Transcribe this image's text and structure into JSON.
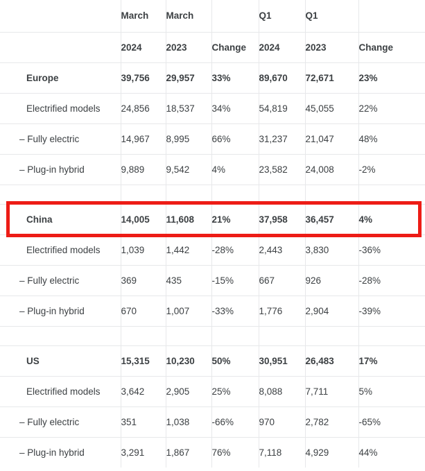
{
  "table": {
    "header_rows": [
      {
        "label": "",
        "cells": [
          "March",
          "March",
          "",
          "Q1",
          "Q1",
          ""
        ]
      },
      {
        "label": "",
        "cells": [
          "2024",
          "2023",
          "Change",
          "2024",
          "2023",
          "Change"
        ]
      }
    ],
    "columns": [
      "",
      "March 2024",
      "March 2023",
      "Change",
      "Q1 2024",
      "Q1 2023",
      "Change"
    ],
    "sections": [
      {
        "name": "Europe",
        "highlighted": false,
        "rows": [
          {
            "label": "Europe",
            "indent": 0,
            "bold": true,
            "cells": [
              "39,756",
              "29,957",
              "33%",
              "89,670",
              "72,671",
              "23%"
            ]
          },
          {
            "label": "Electrified models",
            "indent": 0,
            "bold": false,
            "cells": [
              "24,856",
              "18,537",
              "34%",
              "54,819",
              "45,055",
              "22%"
            ]
          },
          {
            "label": "– Fully electric",
            "indent": 1,
            "bold": false,
            "cells": [
              "14,967",
              "8,995",
              "66%",
              "31,237",
              "21,047",
              "48%"
            ]
          },
          {
            "label": "– Plug-in hybrid",
            "indent": 1,
            "bold": false,
            "cells": [
              "9,889",
              "9,542",
              "4%",
              "23,582",
              "24,008",
              "-2%"
            ]
          }
        ]
      },
      {
        "name": "China",
        "highlighted": true,
        "rows": [
          {
            "label": "China",
            "indent": 0,
            "bold": true,
            "cells": [
              "14,005",
              "11,608",
              "21%",
              "37,958",
              "36,457",
              "4%"
            ]
          },
          {
            "label": "Electrified models",
            "indent": 0,
            "bold": false,
            "cells": [
              "1,039",
              "1,442",
              "-28%",
              "2,443",
              "3,830",
              "-36%"
            ]
          },
          {
            "label": "– Fully electric",
            "indent": 1,
            "bold": false,
            "cells": [
              "369",
              "435",
              "-15%",
              "667",
              "926",
              "-28%"
            ]
          },
          {
            "label": "– Plug-in hybrid",
            "indent": 1,
            "bold": false,
            "cells": [
              "670",
              "1,007",
              "-33%",
              "1,776",
              "2,904",
              "-39%"
            ]
          }
        ]
      },
      {
        "name": "US",
        "highlighted": false,
        "rows": [
          {
            "label": "US",
            "indent": 0,
            "bold": true,
            "cells": [
              "15,315",
              "10,230",
              "50%",
              "30,951",
              "26,483",
              "17%"
            ]
          },
          {
            "label": "Electrified models",
            "indent": 0,
            "bold": false,
            "cells": [
              "3,642",
              "2,905",
              "25%",
              "8,088",
              "7,711",
              "5%"
            ]
          },
          {
            "label": "– Fully electric",
            "indent": 1,
            "bold": false,
            "cells": [
              "351",
              "1,038",
              "-66%",
              "970",
              "2,782",
              "-65%"
            ]
          },
          {
            "label": "– Plug-in hybrid",
            "indent": 1,
            "bold": false,
            "cells": [
              "3,291",
              "1,867",
              "76%",
              "7,118",
              "4,929",
              "44%"
            ]
          }
        ]
      }
    ]
  },
  "annotation": {
    "highlight_color": "#ed1c16",
    "highlight_target_row": "China"
  },
  "style": {
    "text_color": "#3c4043",
    "rule_color": "#e7e8ea",
    "background": "#ffffff"
  }
}
